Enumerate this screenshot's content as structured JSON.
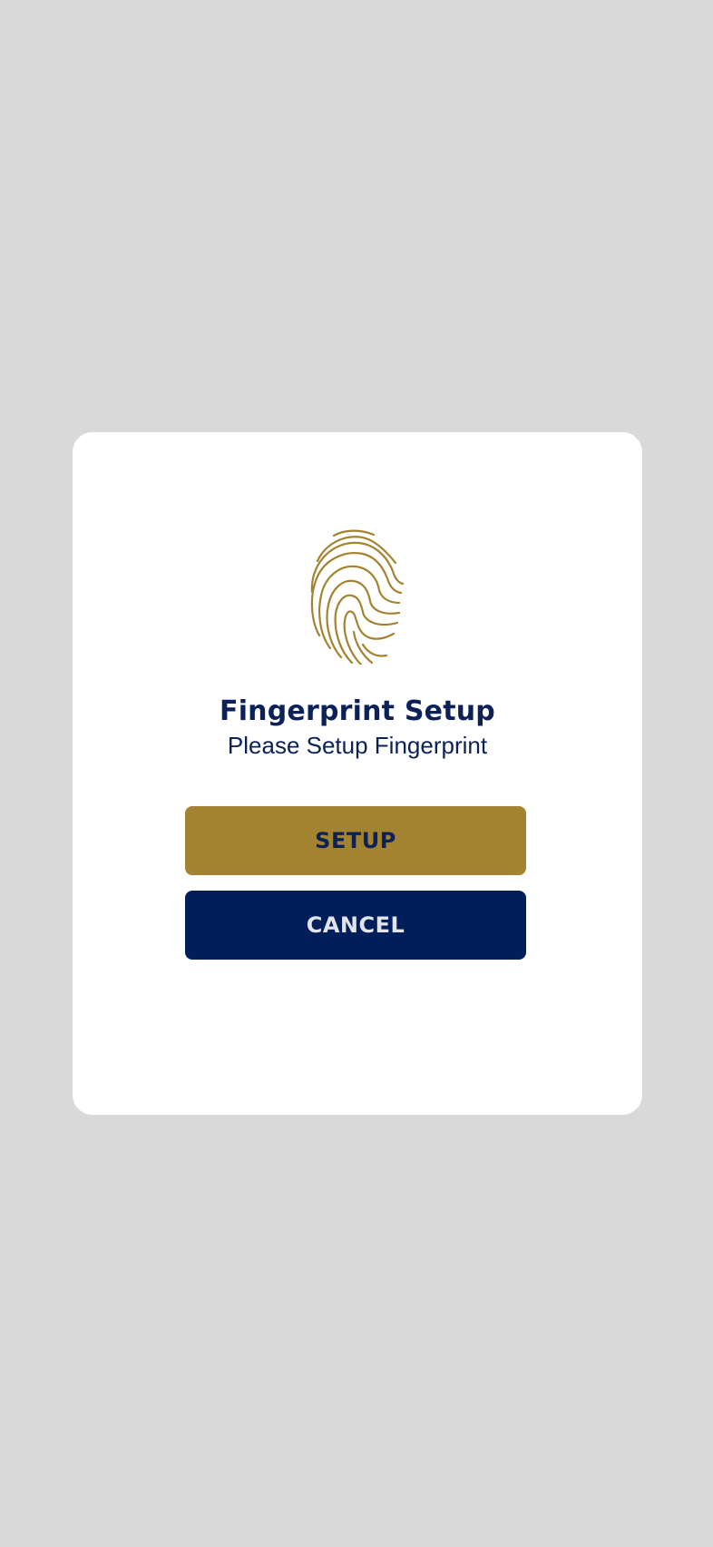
{
  "dialog": {
    "icon": "fingerprint-icon",
    "title": "Fingerprint Setup",
    "subtitle": "Please Setup Fingerprint",
    "setup_label": "SETUP",
    "cancel_label": "CANCEL"
  },
  "colors": {
    "backdrop": "#d9d9d9",
    "dialog_background": "#ffffff",
    "accent_gold": "#a38330",
    "primary_navy": "#001f5a",
    "title_text": "#0b2158",
    "cancel_text": "#e2e4ea"
  }
}
